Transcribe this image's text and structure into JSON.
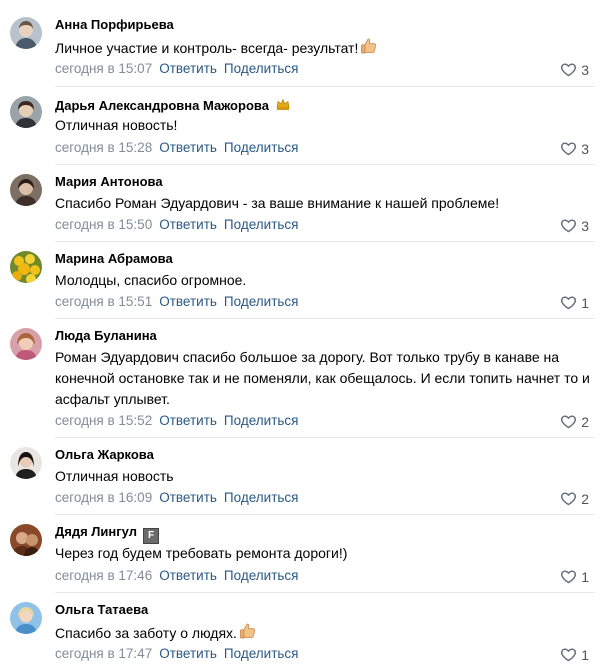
{
  "actions": {
    "reply": "Ответить",
    "share": "Поделиться"
  },
  "colors": {
    "link": "#2a5885",
    "meta": "#818c99",
    "crown": "#e6a817"
  },
  "comments": [
    {
      "author": "Анна Порфирьева",
      "text": "Личное участие и контроль- всегда- результат!",
      "emoji": "thumbs-up",
      "date": "сегодня в 15:07",
      "likes": "3"
    },
    {
      "author": "Дарья Александровна Мажорова",
      "badge": "crown-icon",
      "text": "Отличная новость!",
      "date": "сегодня в 15:28",
      "likes": "3"
    },
    {
      "author": "Мария Антонова",
      "text": "Спасибо Роман Эдуардович - за ваше внимание к нашей проблеме!",
      "date": "сегодня в 15:50",
      "likes": "3"
    },
    {
      "author": "Марина Абрамова",
      "text": "Молодцы, спасибо огромное.",
      "date": "сегодня в 15:51",
      "likes": "1"
    },
    {
      "author": "Люда Буланина",
      "text": "Роман Эдуардович спасибо большое за дорогу. Вот только трубу в канаве на конечной остановке так и не поменяли, как обещалось. И если топить начнет то и асфальт уплывет.",
      "date": "сегодня в 15:52",
      "likes": "2"
    },
    {
      "author": "Ольга Жаркова",
      "text": "Отличная новость",
      "date": "сегодня в 16:09",
      "likes": "2"
    },
    {
      "author": "Дядя Лингул",
      "badge_letter": "F",
      "text": "Через год будем требовать ремонта дороги!)",
      "date": "сегодня в 17:46",
      "likes": "1"
    },
    {
      "author": "Ольга Татаева",
      "text": "Спасибо за заботу о людях.",
      "emoji": "thumbs-up",
      "date": "сегодня в 17:47",
      "likes": "1"
    }
  ]
}
